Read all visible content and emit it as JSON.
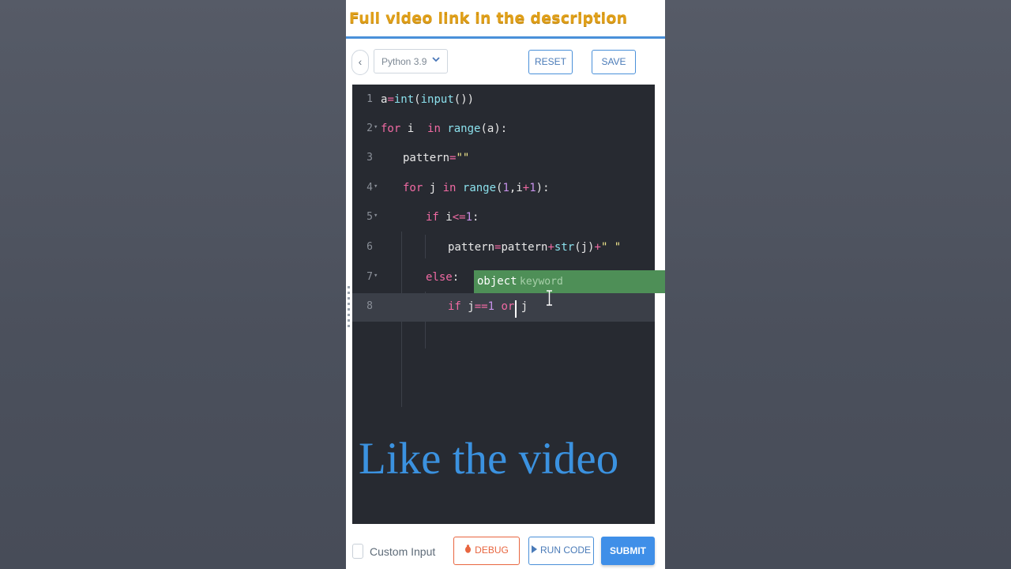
{
  "banner": {
    "text": "Full video link  in the description"
  },
  "toolbar": {
    "back": "‹",
    "language": "Python 3.9",
    "reset": "RESET",
    "save": "SAVE"
  },
  "editor": {
    "lines": [
      {
        "num": "1"
      },
      {
        "num": "2"
      },
      {
        "num": "3"
      },
      {
        "num": "4"
      },
      {
        "num": "5"
      },
      {
        "num": "6"
      },
      {
        "num": "7"
      },
      {
        "num": "8"
      }
    ],
    "autocomplete": {
      "word": "object",
      "type": "keyword"
    }
  },
  "watermark": "Like the video",
  "footer": {
    "custom_input": "Custom Input",
    "debug": "DEBUG",
    "run_code": "RUN CODE",
    "submit": "SUBMIT"
  },
  "colors": {
    "banner_text": "#e0a01a",
    "accent": "#4a90d9",
    "debug": "#e86640",
    "submit_bg": "#3f8fe8",
    "editor_bg": "#272a31",
    "autocomplete_bg": "#4e8f57",
    "watermark": "#3b92e0"
  },
  "icons": {
    "debug": "bug-icon",
    "run": "play-icon",
    "back": "chevron-left-icon",
    "select": "chevron-down-icon"
  }
}
